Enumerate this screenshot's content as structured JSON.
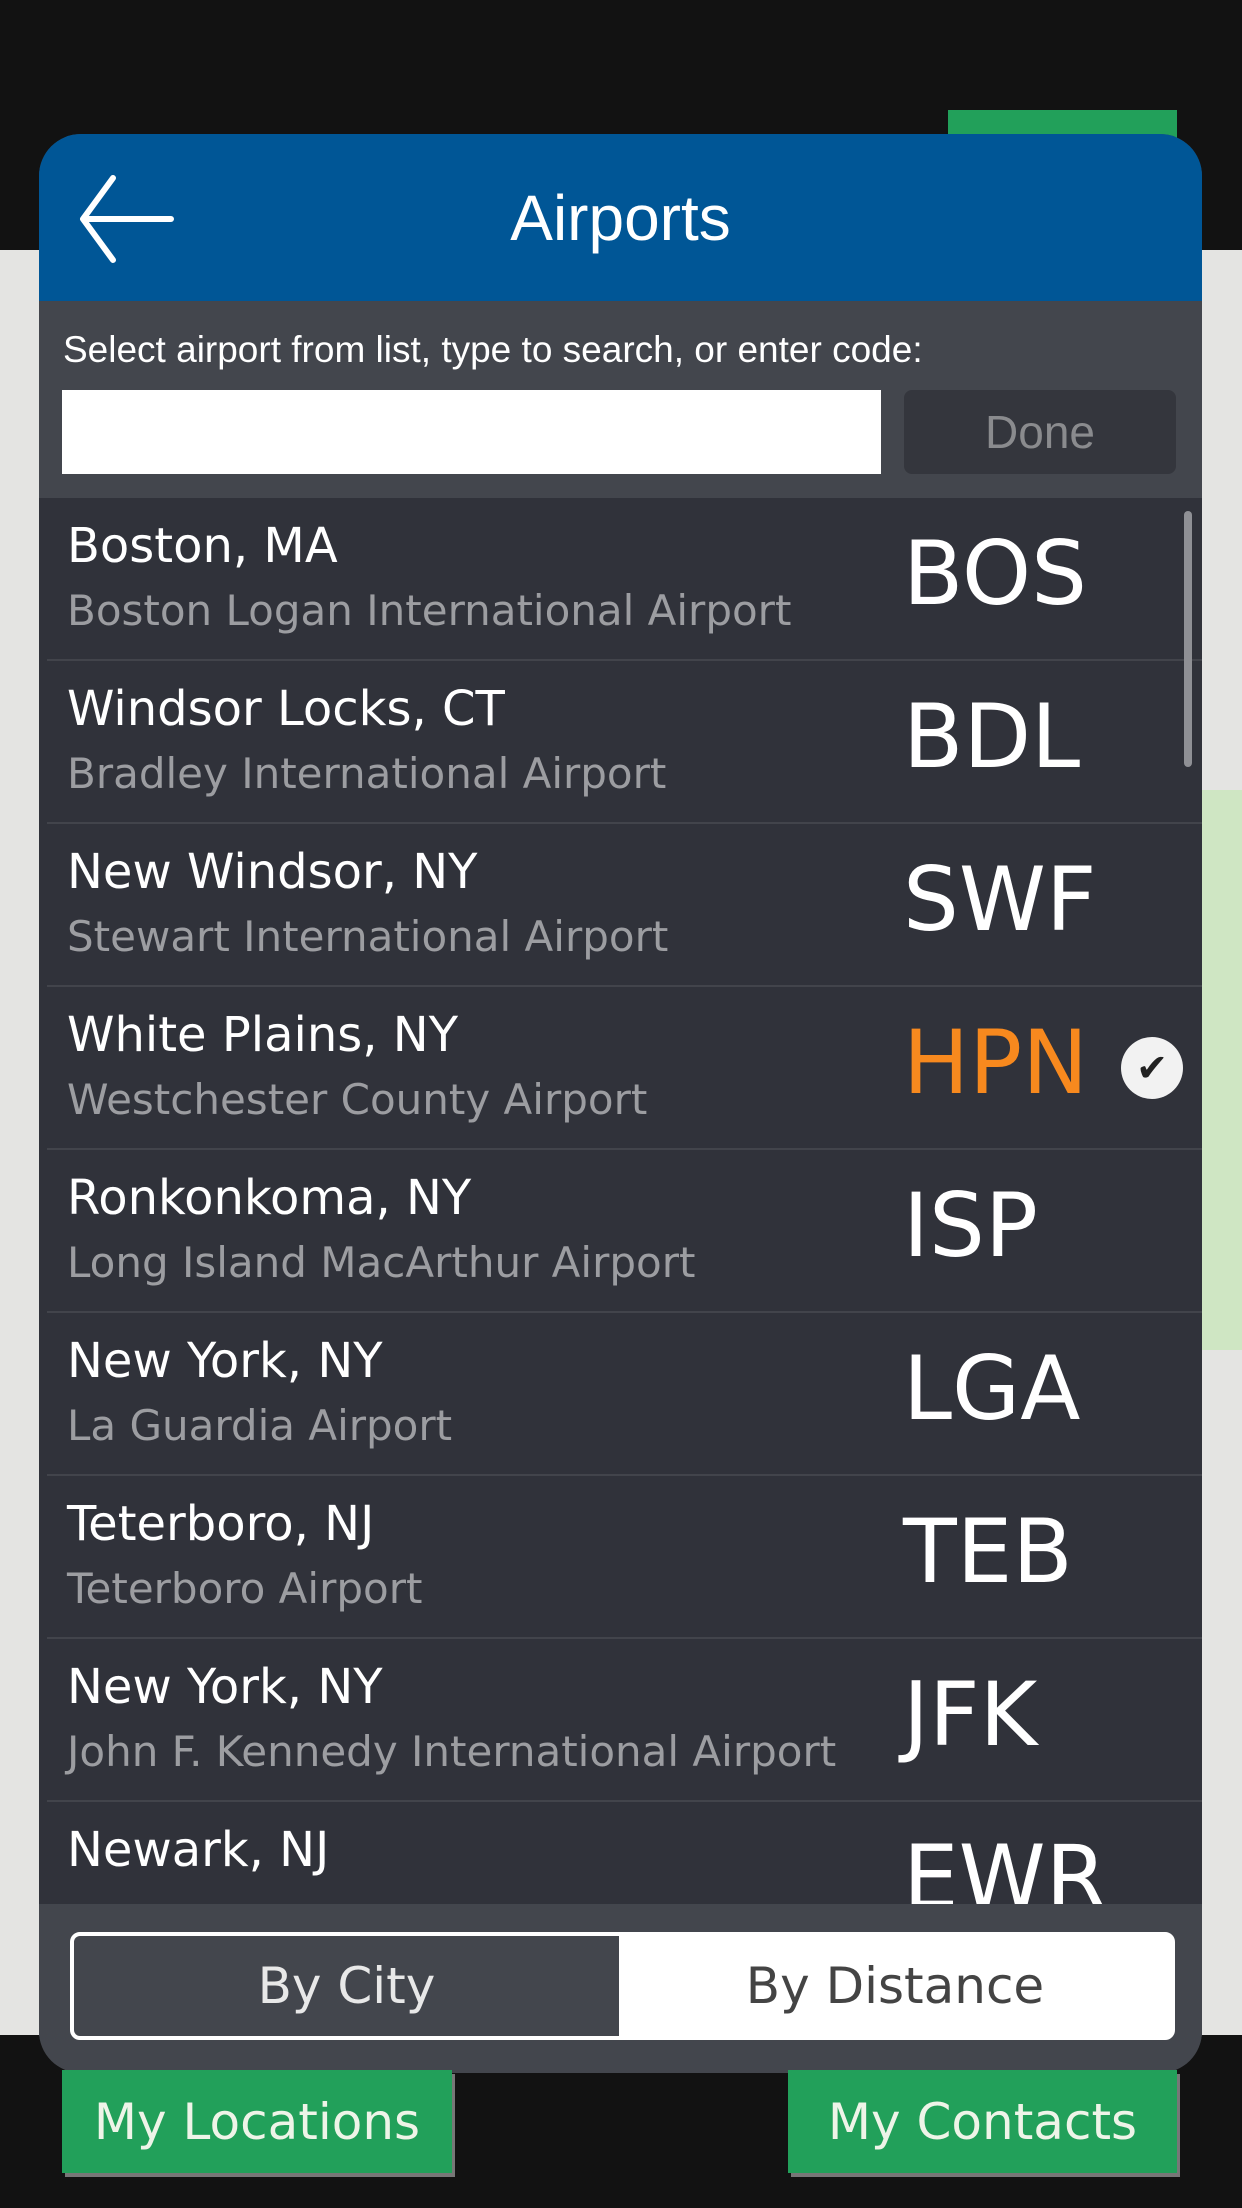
{
  "header": {
    "title": "Airports",
    "back_icon": "arrow-left-icon"
  },
  "search": {
    "instruction": "Select airport from list, type to search, or enter code:",
    "value": "",
    "placeholder": "",
    "done_label": "Done"
  },
  "airports": [
    {
      "city": "Boston, MA",
      "name": "Boston Logan International Airport",
      "code": "BOS",
      "selected": false
    },
    {
      "city": "Windsor Locks, CT",
      "name": "Bradley International Airport",
      "code": "BDL",
      "selected": false
    },
    {
      "city": "New Windsor, NY",
      "name": "Stewart International Airport",
      "code": "SWF",
      "selected": false
    },
    {
      "city": "White Plains, NY",
      "name": "Westchester County Airport",
      "code": "HPN",
      "selected": true
    },
    {
      "city": "Ronkonkoma, NY",
      "name": "Long Island MacArthur Airport",
      "code": "ISP",
      "selected": false
    },
    {
      "city": "New York, NY",
      "name": "La Guardia Airport",
      "code": "LGA",
      "selected": false
    },
    {
      "city": "Teterboro, NJ",
      "name": "Teterboro Airport",
      "code": "TEB",
      "selected": false
    },
    {
      "city": "New York, NY",
      "name": "John F. Kennedy International Airport",
      "code": "JFK",
      "selected": false
    },
    {
      "city": "Newark, NJ",
      "name": "",
      "code": "EWR",
      "selected": false
    }
  ],
  "sort": {
    "options": [
      "By City",
      "By Distance"
    ],
    "selected": "By City"
  },
  "bottom": {
    "my_locations": "My Locations",
    "my_contacts": "My Contacts"
  },
  "colors": {
    "header": "#005696",
    "selected_code": "#f7891e",
    "button_green": "#22a05a"
  }
}
